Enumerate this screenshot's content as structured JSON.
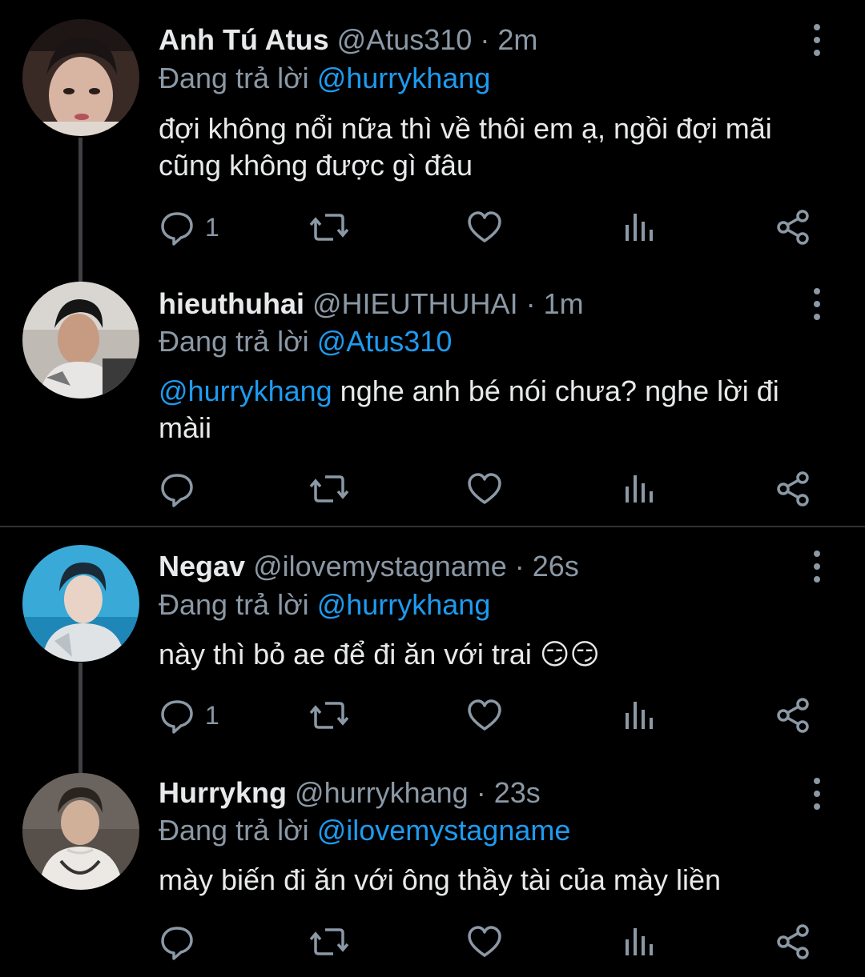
{
  "reply_prefix": "Đang trả lời",
  "colors": {
    "background": "#000000",
    "text": "#e7e9ea",
    "muted": "#8b98a5",
    "accent": "#1d9bf0",
    "divider": "#2f3336"
  },
  "tweets": [
    {
      "name": "Anh Tú Atus",
      "handle": "@Atus310",
      "separator": "·",
      "time": "2m",
      "replying_to": "@hurrykhang",
      "text": "đợi không nổi nữa thì về thôi em ạ, ngồi đợi mãi cũng không được gì đâu",
      "reply_count": "1",
      "avatar_icon": "user-avatar"
    },
    {
      "name": "hieuthuhai",
      "handle": "@HIEUTHUHAI",
      "separator": "·",
      "time": "1m",
      "replying_to": "@Atus310",
      "mention": "@hurrykhang",
      "text": "nghe anh bé nói chưa? nghe lời đi màii",
      "reply_count": "",
      "avatar_icon": "user-avatar"
    },
    {
      "name": "Negav",
      "handle": "@ilovemystagname",
      "separator": "·",
      "time": "26s",
      "replying_to": "@hurrykhang",
      "text": "này thì bỏ ae để đi ăn với trai",
      "emoji": "😏😏",
      "reply_count": "1",
      "avatar_icon": "user-avatar"
    },
    {
      "name": "Hurrykng",
      "handle": "@hurrykhang",
      "separator": "·",
      "time": "23s",
      "replying_to": "@ilovemystagname",
      "text": "mày biến đi ăn với ông thầy tài của mày liền",
      "reply_count": "",
      "avatar_icon": "user-avatar"
    }
  ],
  "icons": [
    "reply-icon",
    "retweet-icon",
    "like-icon",
    "analytics-icon",
    "share-icon",
    "more-icon"
  ]
}
